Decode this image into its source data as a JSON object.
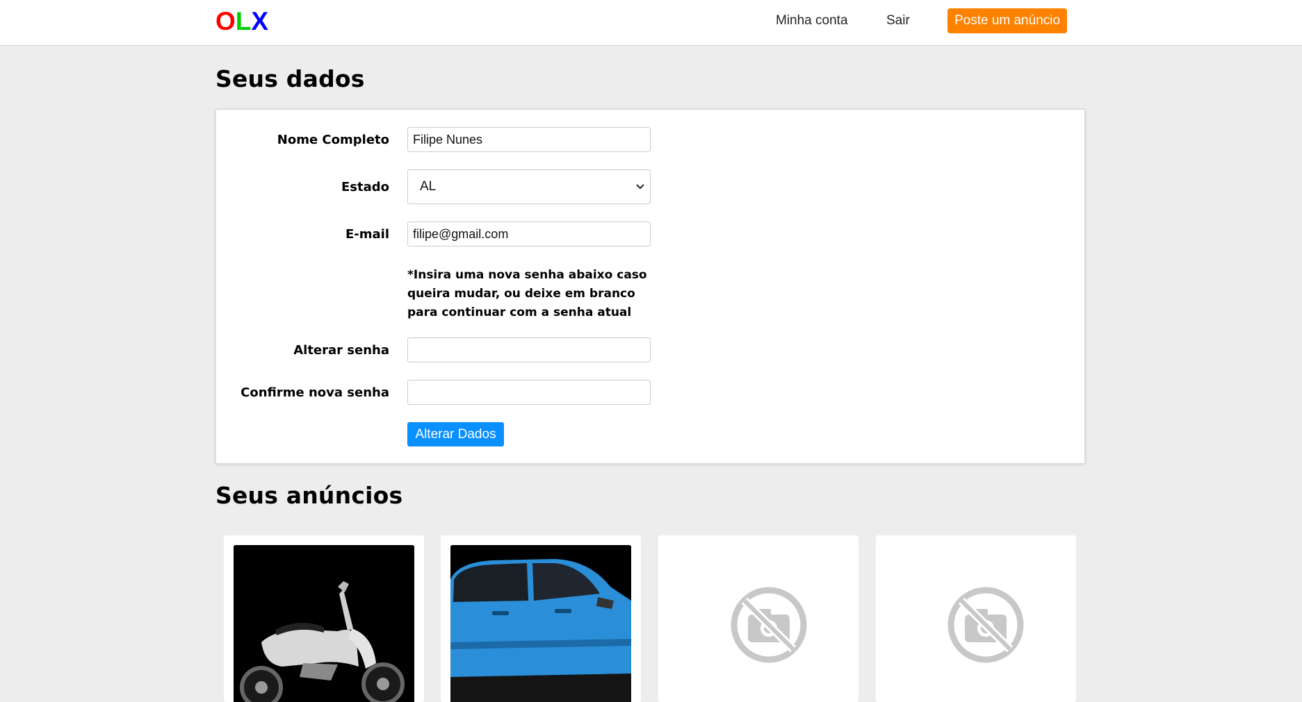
{
  "header": {
    "logo": {
      "o": "O",
      "l": "L",
      "x": "X"
    },
    "nav": {
      "account": "Minha conta",
      "logout": "Sair",
      "post_ad": "Poste um anúncio"
    }
  },
  "profile": {
    "title": "Seus dados",
    "fields": {
      "name_label": "Nome Completo",
      "name_value": "Filipe Nunes",
      "state_label": "Estado",
      "state_value": "AL",
      "email_label": "E-mail",
      "email_value": "filipe@gmail.com",
      "note": "*Insira uma nova senha abaixo caso queira mudar, ou deixe em branco para continuar com a senha atual",
      "new_password_label": "Alterar senha",
      "confirm_password_label": "Confirme nova senha"
    },
    "submit": "Alterar Dados"
  },
  "ads": {
    "title": "Seus anúncios",
    "items": [
      {
        "image": "motorcycle-photo"
      },
      {
        "image": "blue-car-photo"
      },
      {
        "image": "no-photo-icon"
      },
      {
        "image": "no-photo-icon"
      }
    ]
  },
  "colors": {
    "logo_o": "#ff0000",
    "logo_l": "#00cc00",
    "logo_x": "#0000ff",
    "post_button": "#ff8100",
    "submit_button": "#0a8fff",
    "background": "#ededed"
  }
}
